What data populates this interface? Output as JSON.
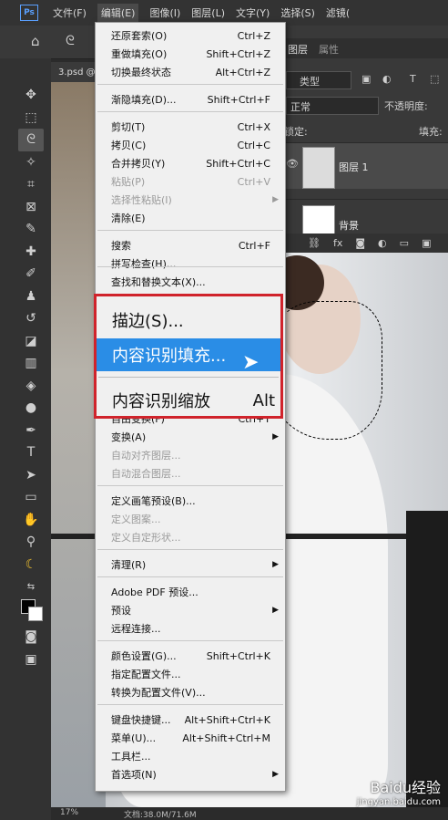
{
  "app": {
    "logo": "Ps"
  },
  "menubar": {
    "items": [
      "文件(F)",
      "编辑(E)",
      "图像(I)",
      "图层(L)",
      "文字(Y)",
      "选择(S)",
      "滤镜("
    ]
  },
  "document_tab": {
    "label": "3.psd @"
  },
  "layers_panel": {
    "tab_label": "图层",
    "properties_tab": "属性",
    "filter_label": "类型",
    "blend_mode": "正常",
    "opacity_label": "不透明度:",
    "lock_label": "锁定:",
    "fill_label": "填充:",
    "layers": [
      {
        "name": "图层 1"
      },
      {
        "name": "背景"
      }
    ]
  },
  "edit_menu": {
    "items": [
      {
        "label": "还原套索(O)",
        "shortcut": "Ctrl+Z",
        "disabled": false
      },
      {
        "label": "重做填充(O)",
        "shortcut": "Shift+Ctrl+Z",
        "disabled": false
      },
      {
        "label": "切换最终状态",
        "shortcut": "Alt+Ctrl+Z",
        "disabled": false
      },
      {
        "label": "渐隐填充(D)...",
        "shortcut": "Shift+Ctrl+F",
        "disabled": false
      },
      {
        "label": "剪切(T)",
        "shortcut": "Ctrl+X",
        "disabled": false
      },
      {
        "label": "拷贝(C)",
        "shortcut": "Ctrl+C",
        "disabled": false
      },
      {
        "label": "合并拷贝(Y)",
        "shortcut": "Shift+Ctrl+C",
        "disabled": false
      },
      {
        "label": "粘贴(P)",
        "shortcut": "Ctrl+V",
        "disabled": true
      },
      {
        "label": "选择性粘贴(I)",
        "shortcut": "",
        "disabled": true
      },
      {
        "label": "清除(E)",
        "shortcut": "",
        "disabled": false
      },
      {
        "label": "搜索",
        "shortcut": "Ctrl+F",
        "disabled": false
      },
      {
        "label": "拼写检查(H)...",
        "shortcut": "",
        "disabled": false
      },
      {
        "label": "查找和替换文本(X)...",
        "shortcut": "",
        "disabled": false
      },
      {
        "label": "自由变换(F)",
        "shortcut": "Ctrl+T",
        "disabled": false
      },
      {
        "label": "变换(A)",
        "shortcut": "",
        "disabled": false
      },
      {
        "label": "自动对齐图层...",
        "shortcut": "",
        "disabled": true
      },
      {
        "label": "自动混合图层...",
        "shortcut": "",
        "disabled": true
      },
      {
        "label": "定义画笔预设(B)...",
        "shortcut": "",
        "disabled": false
      },
      {
        "label": "定义图案...",
        "shortcut": "",
        "disabled": true
      },
      {
        "label": "定义自定形状...",
        "shortcut": "",
        "disabled": true
      },
      {
        "label": "清理(R)",
        "shortcut": "",
        "disabled": false
      },
      {
        "label": "Adobe PDF 预设...",
        "shortcut": "",
        "disabled": false
      },
      {
        "label": "预设",
        "shortcut": "",
        "disabled": false
      },
      {
        "label": "远程连接...",
        "shortcut": "",
        "disabled": false
      },
      {
        "label": "颜色设置(G)...",
        "shortcut": "Shift+Ctrl+K",
        "disabled": false
      },
      {
        "label": "指定配置文件...",
        "shortcut": "",
        "disabled": false
      },
      {
        "label": "转换为配置文件(V)...",
        "shortcut": "",
        "disabled": false
      },
      {
        "label": "键盘快捷键...",
        "shortcut": "Alt+Shift+Ctrl+K",
        "disabled": false
      },
      {
        "label": "菜单(U)...",
        "shortcut": "Alt+Shift+Ctrl+M",
        "disabled": false
      },
      {
        "label": "工具栏...",
        "shortcut": "",
        "disabled": false
      },
      {
        "label": "首选项(N)",
        "shortcut": "",
        "disabled": false
      }
    ],
    "zoomed": {
      "stroke": "描边(S)...",
      "content_aware_fill": "内容识别填充...",
      "content_aware_scale": "内容识别缩放",
      "content_aware_scale_shortcut": "Alt"
    }
  },
  "statusbar": {
    "zoom": "17%",
    "doc_info": "文档:38.0M/71.6M"
  },
  "watermark": {
    "brand": "Baidu经验",
    "url": "jingyan.baidu.com"
  },
  "colors": {
    "highlight": "#2a8de6",
    "callout_border": "#d0232b",
    "menu_bg": "#f0f0f0"
  }
}
